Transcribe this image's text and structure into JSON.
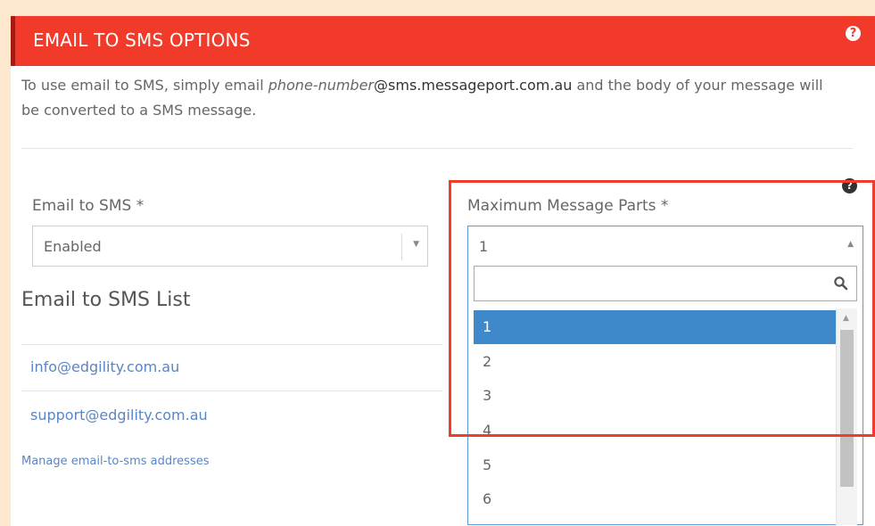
{
  "header": {
    "title": "EMAIL TO SMS OPTIONS",
    "help_glyph": "?"
  },
  "intro": {
    "part1": "To use email to SMS, simply email ",
    "phone_placeholder": "phone-number",
    "domain": "@sms.messageport.com.au",
    "part2": " and the body of your message will be converted to a SMS message."
  },
  "email_to_sms": {
    "label": "Email to SMS *",
    "value": "Enabled"
  },
  "max_parts": {
    "label": "Maximum Message Parts *",
    "help_glyph": "?",
    "value": "1",
    "search_placeholder": "",
    "options": [
      "1",
      "2",
      "3",
      "4",
      "5",
      "6"
    ],
    "selected": "1"
  },
  "list": {
    "title": "Email to SMS List",
    "items": [
      "info@edgility.com.au",
      "support@edgility.com.au"
    ],
    "manage_link": "Manage email-to-sms addresses"
  },
  "colors": {
    "header_bg": "#f23a2a",
    "link": "#5a86c3",
    "selected_option": "#3f88c9",
    "highlight_box": "#ee3d2b"
  }
}
